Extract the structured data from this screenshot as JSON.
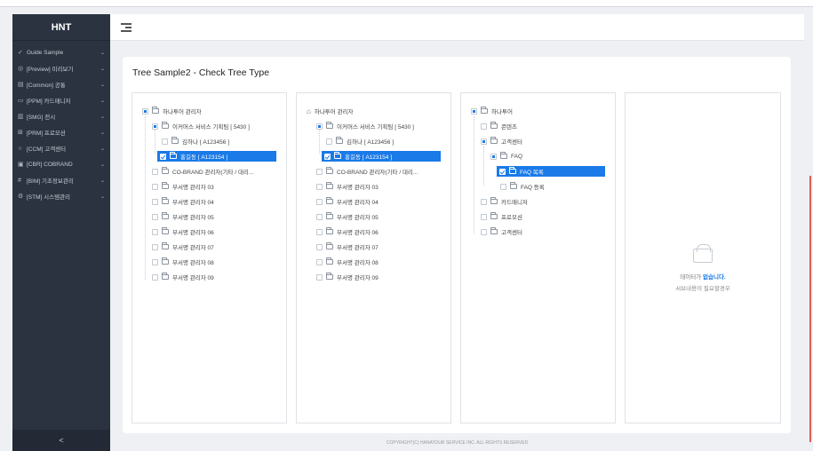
{
  "sidebar": {
    "brand": "HNT",
    "items": [
      {
        "icon": "✓",
        "label": "Guide Sample"
      },
      {
        "icon": "◎",
        "label": "[Preview] 미리보기"
      },
      {
        "icon": "▤",
        "label": "[Common] 공통"
      },
      {
        "icon": "▭",
        "label": "[PPM] 카드매니저"
      },
      {
        "icon": "▥",
        "label": "[SMG] 전시"
      },
      {
        "icon": "⊞",
        "label": "[PRM] 프로모션"
      },
      {
        "icon": "∩",
        "label": "[CCM] 고객센터"
      },
      {
        "icon": "▣",
        "label": "[CBR] COBRAND"
      },
      {
        "icon": "#",
        "label": "[BIM] 기초정보관리"
      },
      {
        "icon": "⚙",
        "label": "[STM] 시스템관리"
      }
    ],
    "collapse_label": "<"
  },
  "card": {
    "title": "Tree Sample2 - Check Tree Type"
  },
  "tree1": [
    {
      "text": "하나투어 관리자"
    },
    {
      "text": "이커머스 서비스 기획팀 [ 5430 ]"
    },
    {
      "text": "김하나 [ A123456 ]"
    },
    {
      "text": "홍길동 [ A123154 ]"
    },
    {
      "text": "CO-BRAND 관리자(기타 / 대리..."
    },
    {
      "text": "부서명 관리자 03"
    },
    {
      "text": "부서명 관리자 04"
    },
    {
      "text": "부서명 관리자 05"
    },
    {
      "text": "부서명 관리자 06"
    },
    {
      "text": "부서명 관리자 07"
    },
    {
      "text": "부서명 관리자 08"
    },
    {
      "text": "부서명 관리자 09"
    }
  ],
  "tree2": [
    {
      "text": "하나투어 관리자"
    },
    {
      "text": "이커머스 서비스 기획팀 [ 5430 ]"
    },
    {
      "text": "김하나 [ A123456 ]"
    },
    {
      "text": "홍길동 [ A123154 ]"
    },
    {
      "text": "CO-BRAND 관리자(기타 / 대리..."
    },
    {
      "text": "부서명 관리자 03"
    },
    {
      "text": "부서명 관리자 04"
    },
    {
      "text": "부서명 관리자 05"
    },
    {
      "text": "부서명 관리자 06"
    },
    {
      "text": "부서명 관리자 07"
    },
    {
      "text": "부서명 관리자 08"
    },
    {
      "text": "부서명 관리자 09"
    }
  ],
  "tree3": [
    {
      "text": "하나투어"
    },
    {
      "text": "콘텐츠"
    },
    {
      "text": "고객센터"
    },
    {
      "text": "FAQ"
    },
    {
      "text": "FAQ 목록"
    },
    {
      "text": "FAQ 등록"
    },
    {
      "text": "카드매니저"
    },
    {
      "text": "프로모션"
    },
    {
      "text": "고객센터"
    }
  ],
  "empty": {
    "line1_prefix": "데이터가 ",
    "line1_emphasis": "없습니다.",
    "line2": "서브내용이 필요할경우"
  },
  "footer": {
    "copyright": "COPYRIGHT(C) HANATOUR SERVICE INC. ALL RIGHTS RESERVED"
  },
  "colors": {
    "accent": "#1a7ae8",
    "sidebar": "#2b3340"
  }
}
